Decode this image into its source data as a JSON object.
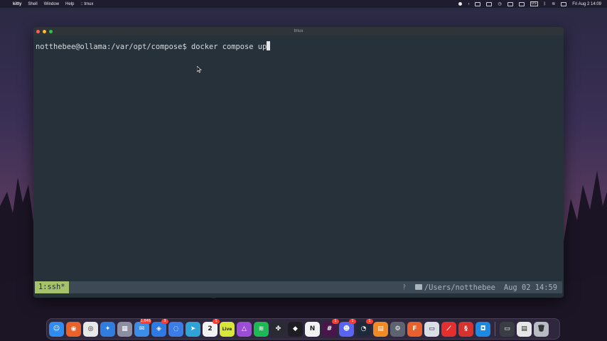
{
  "menubar": {
    "app_name": "kitty",
    "menus": [
      "Shell",
      "Window",
      "Help",
      ":: tmux"
    ],
    "input_source": "US",
    "datetime": "Fri Aug 2 14:09"
  },
  "window": {
    "title": "tmux",
    "prompt": "notthebee@ollama:/var/opt/compose$ ",
    "command": "docker compose up"
  },
  "tmux_status": {
    "window_tab": "1:ssh*",
    "path": "/Users/notthebee",
    "datetime": "Aug 02 14:59"
  },
  "dock": {
    "apps": [
      {
        "name": "finder",
        "color": "#2f8cf0",
        "glyph": "☺"
      },
      {
        "name": "firefox",
        "color": "#e8622a",
        "glyph": "◉"
      },
      {
        "name": "chrome",
        "color": "#e8e8e8",
        "glyph": "◎"
      },
      {
        "name": "safari",
        "color": "#2f7de1",
        "glyph": "✦"
      },
      {
        "name": "launchpad",
        "color": "#8c8fa0",
        "glyph": "▦"
      },
      {
        "name": "mail",
        "color": "#3b8de8",
        "glyph": "✉",
        "badge": "1,648"
      },
      {
        "name": "app-store",
        "color": "#2c7be5",
        "glyph": "◈",
        "badge": "3"
      },
      {
        "name": "messages",
        "color": "#3a7de8",
        "glyph": "◌"
      },
      {
        "name": "telegram",
        "color": "#2fa3d8",
        "glyph": "➤"
      },
      {
        "name": "calendar",
        "color": "#f2f2f2",
        "glyph": "2",
        "badge": "1"
      },
      {
        "name": "live",
        "color": "#d8e63a",
        "glyph": "Live"
      },
      {
        "name": "affinity",
        "color": "#9b4dd8",
        "glyph": "△"
      },
      {
        "name": "spotify",
        "color": "#1db954",
        "glyph": "≋"
      },
      {
        "name": "davinci",
        "color": "#2a2a33",
        "glyph": "✤"
      },
      {
        "name": "app-dark",
        "color": "#1e1e22",
        "glyph": "◆"
      },
      {
        "name": "notion",
        "color": "#f2f2f2",
        "glyph": "N"
      },
      {
        "name": "slack",
        "color": "#4a154b",
        "glyph": "#",
        "badge": "1"
      },
      {
        "name": "discord",
        "color": "#5865f2",
        "glyph": "☻",
        "badge": "1"
      },
      {
        "name": "activity",
        "color": "#1e2a3a",
        "glyph": "◔",
        "badge": "1"
      },
      {
        "name": "pages",
        "color": "#f08a24",
        "glyph": "▤"
      },
      {
        "name": "settings",
        "color": "#5d6470",
        "glyph": "⚙"
      },
      {
        "name": "fusion",
        "color": "#e8612c",
        "glyph": "F"
      },
      {
        "name": "screens",
        "color": "#d8dde6",
        "glyph": "▭"
      },
      {
        "name": "acrobat",
        "color": "#e52e2e",
        "glyph": "⟋"
      },
      {
        "name": "git",
        "color": "#d8322e",
        "glyph": "§"
      },
      {
        "name": "vpn",
        "color": "#1e88e5",
        "glyph": "◘"
      }
    ],
    "trailing": [
      {
        "name": "terminal-folder",
        "color": "#3a3d44",
        "glyph": "▭"
      },
      {
        "name": "document",
        "color": "#e6e6e6",
        "glyph": "▤"
      },
      {
        "name": "trash",
        "color": "#b8bcc4",
        "glyph": "🗑"
      }
    ]
  }
}
